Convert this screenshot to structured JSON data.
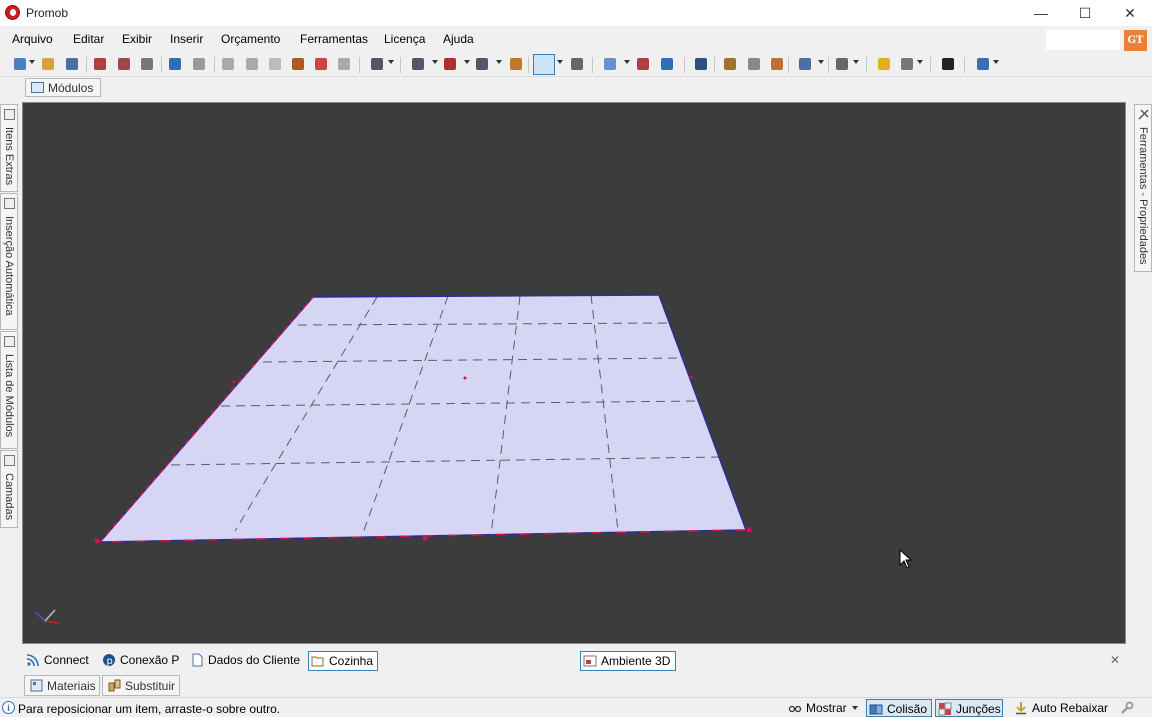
{
  "window": {
    "title": "Promob",
    "minimize_glyph": "—",
    "maximize_glyph": "☐",
    "close_glyph": "✕"
  },
  "menu": [
    "Arquivo",
    "Editar",
    "Exibir",
    "Inserir",
    "Orçamento",
    "Ferramentas",
    "Licença",
    "Ajuda"
  ],
  "user_badge": "GT",
  "toolbar": {
    "icons": [
      "new-file-icon",
      "open-folder-icon",
      "save-icon",
      "render-icon",
      "render-alt-icon",
      "print-icon",
      "undo-icon",
      "redo-icon",
      "cut-icon",
      "copy-icon",
      "paste-icon",
      "hammer-icon",
      "paint-roller-icon",
      "delete-icon",
      "modules-icon",
      "views-icon",
      "group-icon",
      "shapes-icon",
      "door-icon",
      "select-arrow-icon",
      "measure-icon",
      "layers-icon",
      "wardrobe-icon",
      "3d-icon",
      "eye-icon",
      "rotate-icon",
      "move-left-icon",
      "move-right-icon",
      "cube-view-icon",
      "box-icon",
      "light-icon",
      "camera-icon",
      "move-all-icon",
      "layout-icon"
    ]
  },
  "modules_tab": {
    "label": "Módulos"
  },
  "left_tabs": [
    {
      "label": "Itens Extras",
      "icon": "items-icon"
    },
    {
      "label": "Inserção Automática",
      "icon": "auto-insert-icon"
    },
    {
      "label": "Lista de Módulos",
      "icon": "list-icon"
    },
    {
      "label": "Camadas",
      "icon": "layers-icon"
    }
  ],
  "right_tab": {
    "label": "Ferramentas - Propriedades",
    "icon": "tools-icon"
  },
  "colors": {
    "viewport_bg": "#3c3c3c",
    "floor_fill": "#d6d6f4",
    "floor_edge_blue": "#2b2b9a",
    "floor_edge_red": "#d4124a",
    "grid_dash": "#555555"
  },
  "bottom_tabs": [
    {
      "label": "Connect",
      "icon": "rss-icon",
      "active": false
    },
    {
      "label": "Conexão P",
      "icon": "connection-icon",
      "active": false
    },
    {
      "label": "Dados do Cliente",
      "icon": "document-icon",
      "active": false
    },
    {
      "label": "Cozinha",
      "icon": "folder-icon",
      "active": true
    },
    {
      "label": "Ambiente 3D",
      "icon": "environment-icon",
      "active": true
    }
  ],
  "close_panel_glyph": "✕",
  "secondary_tabs": [
    {
      "label": "Materiais",
      "icon": "materials-icon"
    },
    {
      "label": "Substituir",
      "icon": "replace-icon"
    }
  ],
  "status": {
    "message": "Para reposicionar um item, arraste-o sobre outro.",
    "info_glyph": "i",
    "items": [
      {
        "label": "Mostrar",
        "icon": "show-icon",
        "pressed": false,
        "dropdown": true
      },
      {
        "label": "Colisão",
        "icon": "collision-icon",
        "pressed": true
      },
      {
        "label": "Junções",
        "icon": "joints-icon",
        "pressed": true
      },
      {
        "label": "Auto Rebaixar",
        "icon": "auto-lower-icon",
        "pressed": false
      },
      {
        "label": "",
        "icon": "wrench-icon",
        "pressed": false
      }
    ]
  }
}
